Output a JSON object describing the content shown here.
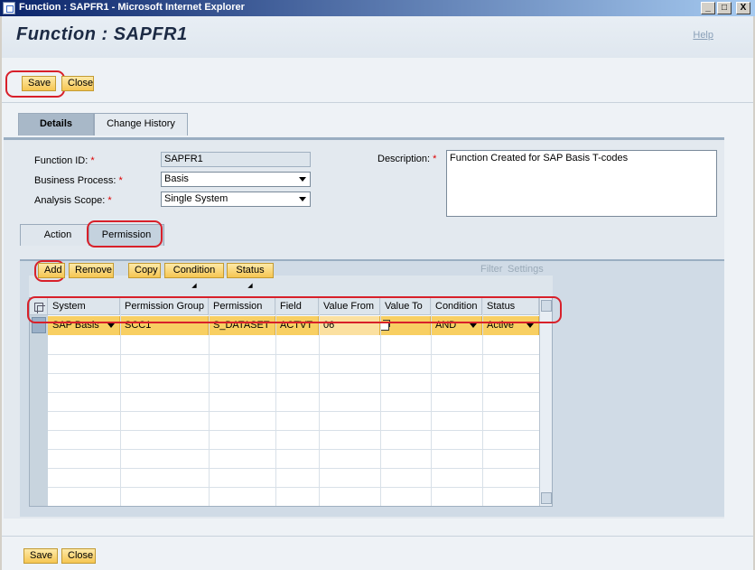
{
  "window": {
    "title": "Function : SAPFR1 - Microsoft Internet Explorer",
    "minimize": "_",
    "maximize": "□",
    "close": "X"
  },
  "header": {
    "title": "Function : SAPFR1",
    "help": "Help"
  },
  "top_actions": {
    "save": "Save",
    "close": "Close"
  },
  "tabs": [
    {
      "label": "Details",
      "active": true
    },
    {
      "label": "Change History",
      "active": false
    }
  ],
  "form": {
    "function_id": {
      "label": "Function ID:",
      "value": "SAPFR1"
    },
    "business_process": {
      "label": "Business Process:",
      "value": "Basis"
    },
    "analysis_scope": {
      "label": "Analysis Scope:",
      "value": "Single System"
    },
    "description": {
      "label": "Description:",
      "value": "Function Created for SAP Basis T-codes"
    },
    "required_marker": "*"
  },
  "subtabs": [
    {
      "label": "Action",
      "active": false
    },
    {
      "label": "Permission",
      "active": true
    }
  ],
  "toolbar": {
    "add": "Add",
    "remove": "Remove",
    "copy": "Copy",
    "condition": "Condition",
    "status": "Status",
    "filter": "Filter",
    "settings": "Settings"
  },
  "grid": {
    "columns": [
      "System",
      "Permission Group",
      "Permission",
      "Field",
      "Value From",
      "Value To",
      "Condition",
      "Status"
    ],
    "rows": [
      [
        "SAP Basis",
        "SCC1",
        "S_DATASET",
        "ACTVT",
        "06",
        "",
        "AND",
        "Active"
      ]
    ]
  },
  "bottom_actions": {
    "save": "Save",
    "close": "Close"
  },
  "colors": {
    "accent": "#f6c652",
    "highlight": "#d8202a",
    "title_bar": "#0a246a"
  }
}
